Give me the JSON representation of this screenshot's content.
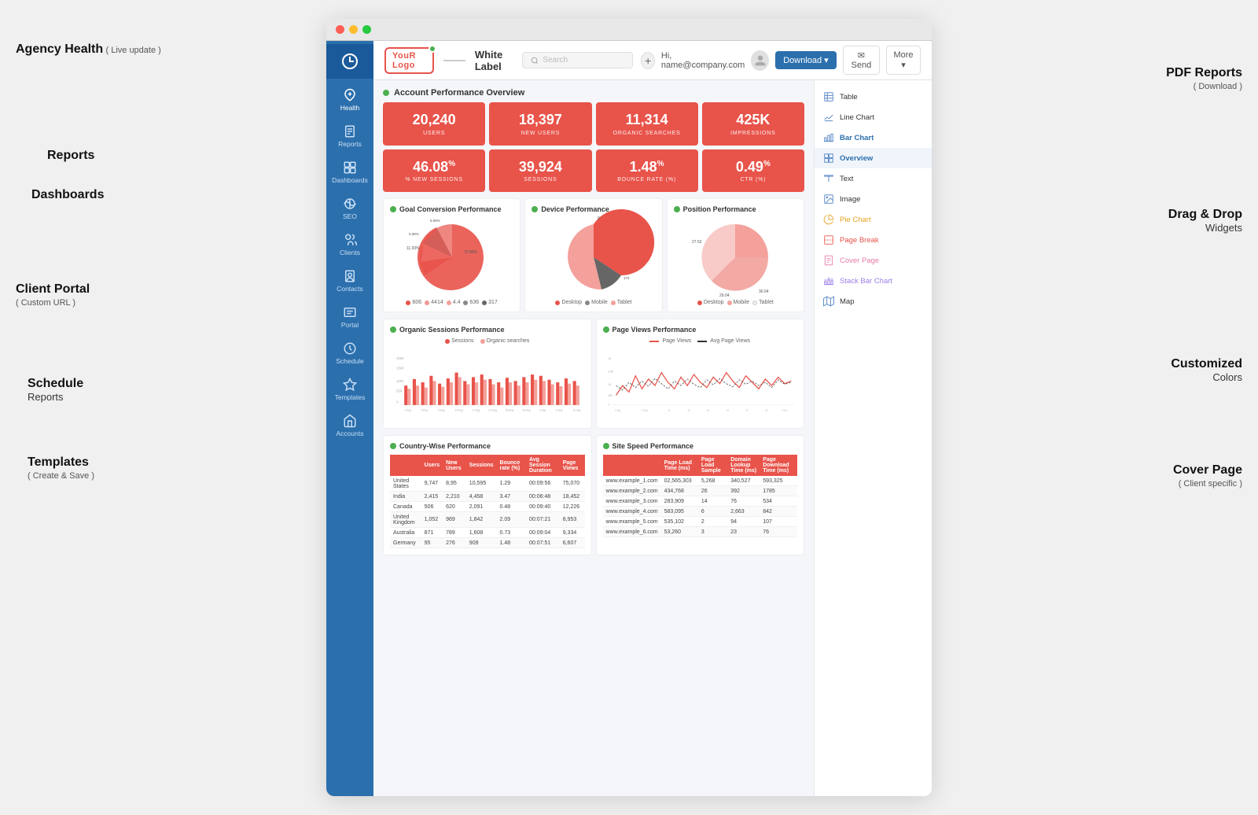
{
  "annotations": {
    "agency": {
      "title": "Agency Health",
      "sub": "( Live update )"
    },
    "reports": {
      "title": "Reports"
    },
    "dashboards": {
      "title": "Dashboards"
    },
    "portal": {
      "title": "Client Portal",
      "sub": "( Custom URL )"
    },
    "schedule": {
      "title": "Schedule",
      "sub2": "Reports"
    },
    "templates": {
      "title": "Templates",
      "sub": "( Create & Save )"
    },
    "pdf": {
      "title": "PDF Reports",
      "sub": "( Download )"
    },
    "drag": {
      "title": "Drag & Drop",
      "sub": "Widgets"
    },
    "colors": {
      "title": "Customized",
      "sub": "Colors"
    },
    "cover": {
      "title": "Cover Page",
      "sub": "( Client specific )"
    }
  },
  "browser": {
    "titlebar": {
      "dots": [
        "red",
        "yellow",
        "green"
      ]
    }
  },
  "topbar": {
    "logo": "YouR Logo",
    "white_label": "White",
    "label_suffix": " Label",
    "search_placeholder": "Search",
    "email": "Hi, name@company.com",
    "download": "Download",
    "send": "Send",
    "more": "More"
  },
  "sidebar": {
    "items": [
      {
        "label": "Health",
        "active": true
      },
      {
        "label": "Reports",
        "active": false
      },
      {
        "label": "Dashboards",
        "active": false
      },
      {
        "label": "SEO",
        "active": false
      },
      {
        "label": "Clients",
        "active": false
      },
      {
        "label": "Contacts",
        "active": false
      },
      {
        "label": "Portal",
        "active": false
      },
      {
        "label": "Schedule",
        "active": false
      },
      {
        "label": "Templates",
        "active": false
      },
      {
        "label": "Accounts",
        "active": false
      }
    ]
  },
  "dashboard": {
    "section_title": "Account Performance Overview",
    "stats": [
      {
        "value": "20,240",
        "label": "USERS",
        "sup": ""
      },
      {
        "value": "18,397",
        "label": "NEW USERS",
        "sup": ""
      },
      {
        "value": "11,314",
        "label": "ORGANIC SEARCHES",
        "sup": ""
      },
      {
        "value": "425K",
        "label": "IMPRESSIONS",
        "sup": ""
      },
      {
        "value": "46.08",
        "label": "% NEW SESSIONS",
        "sup": "%"
      },
      {
        "value": "39,924",
        "label": "SESSIONS",
        "sup": ""
      },
      {
        "value": "1.48",
        "label": "BOUNCE RATE (%)",
        "sup": "%"
      },
      {
        "value": "0.49",
        "label": "CTR (%)",
        "sup": "%"
      }
    ],
    "charts": {
      "goal": {
        "title": "Goal Conversion Performance",
        "legend": [
          "606",
          "4414",
          "4.4",
          "636",
          "317"
        ]
      },
      "device": {
        "title": "Device Performance",
        "legend_items": [
          "Desktop",
          "Mobile",
          "Tablet"
        ],
        "value": 172
      },
      "position": {
        "title": "Position Performance",
        "legend_items": [
          "Desktop",
          "Mobile",
          "Tablet"
        ],
        "values": [
          "27.52",
          "30.04",
          "29.04"
        ]
      }
    },
    "organic": {
      "title": "Organic Sessions Performance",
      "legend": [
        "Sessions",
        "Organic searches"
      ]
    },
    "pageviews": {
      "title": "Page Views Performance",
      "legend": [
        "Page Views",
        "Avg Page Views"
      ]
    },
    "country": {
      "title": "Country-Wise Performance",
      "columns": [
        "Users",
        "New Users",
        "Sessions",
        "Bounce rate (%)",
        "Avg Session Duration",
        "Page Views"
      ],
      "rows": [
        [
          "United States",
          "9,747",
          "8,95",
          "10,595",
          "1.29",
          "00:09:56",
          "75,070"
        ],
        [
          "India",
          "2,415",
          "2,210",
          "4,458",
          "3.47",
          "00:06:48",
          "18,452"
        ],
        [
          "Canada",
          "506",
          "620",
          "2,091",
          "0.48",
          "00:09:40",
          "12,226"
        ],
        [
          "United Kingdom",
          "1,052",
          "969",
          "1,842",
          "2.09",
          "00:07:21",
          "8,953"
        ],
        [
          "Australia",
          "871",
          "789",
          "1,608",
          "0.73",
          "00:09:04",
          "9,334"
        ],
        [
          "Germany",
          "95",
          "276",
          "909",
          "1.48",
          "00:07:51",
          "6,607"
        ]
      ]
    },
    "sitespeed": {
      "title": "Site Speed Performance",
      "columns": [
        "Page Load Time (ms)",
        "Page Load Sample",
        "Domain Lookup Time (ms)",
        "Page Download Time (ms)"
      ],
      "rows": [
        [
          "www.example_1.com",
          "02,565,303",
          "5,268",
          "340,527",
          "593,325"
        ],
        [
          "www.example_2.com",
          "434,768",
          "26",
          "392",
          "1785"
        ],
        [
          "www.example_3.com",
          "283,909",
          "14",
          "76",
          "534"
        ],
        [
          "www.example_4.com",
          "583,095",
          "6",
          "2,663",
          "842"
        ],
        [
          "www.example_5.com",
          "535,102",
          "2",
          "94",
          "107"
        ],
        [
          "www.example_6.com",
          "53,260",
          "3",
          "23",
          "76"
        ]
      ]
    }
  },
  "widgets": [
    {
      "label": "Table",
      "icon": "table-icon"
    },
    {
      "label": "Line Chart",
      "icon": "line-chart-icon"
    },
    {
      "label": "Bar Chart",
      "icon": "bar-chart-icon",
      "active": true
    },
    {
      "label": "Overview",
      "icon": "overview-icon"
    },
    {
      "label": "Text",
      "icon": "text-icon"
    },
    {
      "label": "Image",
      "icon": "image-icon"
    },
    {
      "label": "Pie Chart",
      "icon": "pie-chart-icon"
    },
    {
      "label": "Page Break",
      "icon": "page-break-icon"
    },
    {
      "label": "Cover Page",
      "icon": "cover-page-icon"
    },
    {
      "label": "Stack Bar Chart",
      "icon": "stack-bar-icon"
    },
    {
      "label": "Map",
      "icon": "map-icon"
    }
  ]
}
